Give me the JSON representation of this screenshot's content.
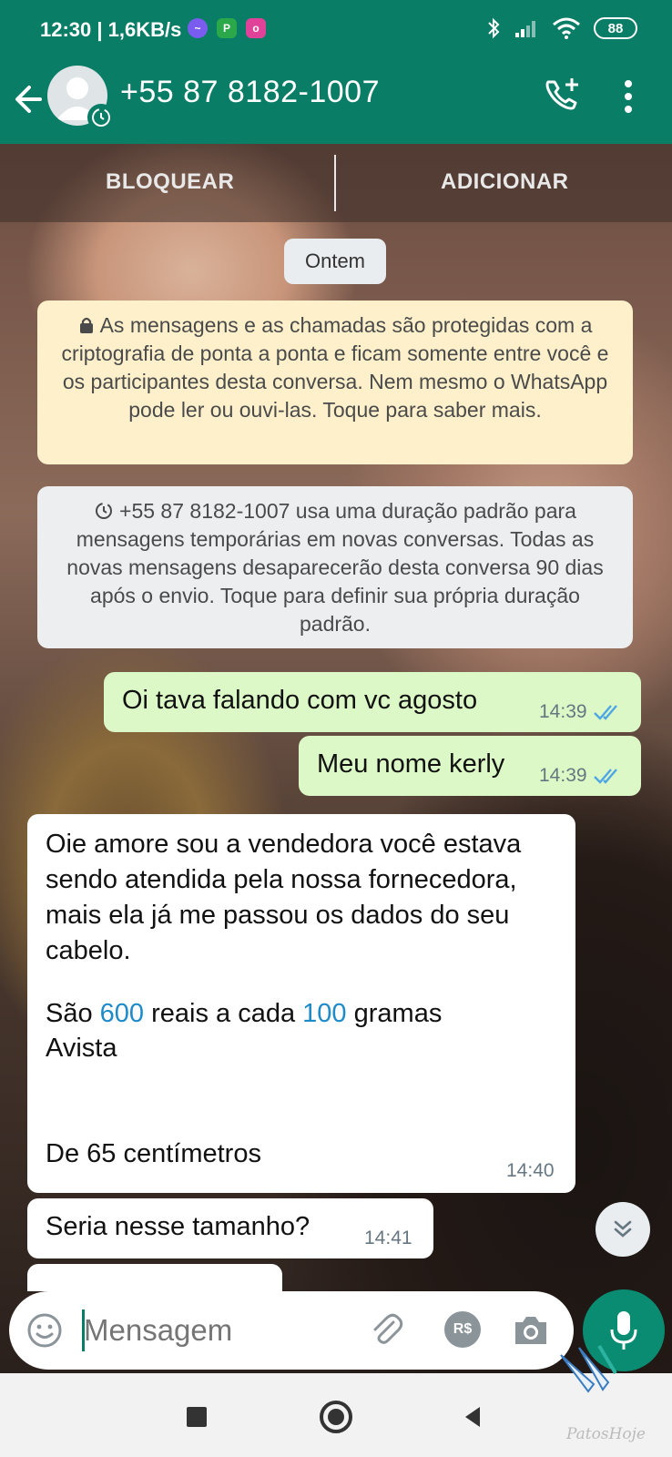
{
  "status_bar": {
    "time": "12:30 | 1,6KB/s",
    "battery": "88"
  },
  "header": {
    "contact": "+55 87 8182-1007"
  },
  "actions": {
    "block": "BLOQUEAR",
    "add": "ADICIONAR"
  },
  "date_chip": "Ontem",
  "notices": {
    "encryption": "As mensagens e as chamadas são protegidas com a criptografia de ponta a ponta e ficam somente entre você e os participantes desta conversa. Nem mesmo o WhatsApp pode ler ou ouvi-las. Toque para saber mais.",
    "temporary": "+55 87 8182-1007 usa uma duração padrão para mensagens temporárias em novas conversas. Todas as novas mensagens desaparecerão desta conversa 90 dias após o envio. Toque para definir sua própria duração padrão."
  },
  "messages": [
    {
      "direction": "out",
      "text": "Oi tava falando com vc agosto",
      "time": "14:39"
    },
    {
      "direction": "out",
      "text": "Meu nome kerly",
      "time": "14:39"
    },
    {
      "direction": "in",
      "line1": "Oie amore sou a vendedora você estava sendo atendida pela nossa fornecedora,  mais ela já me passou os dados do seu cabelo.",
      "price_prefix": "São ",
      "price_value": "600",
      "price_mid": " reais a cada ",
      "price_grams": "100",
      "price_suffix": " gramas",
      "payment": "Avista",
      "length": "De 65 centímetros",
      "time": "14:40"
    },
    {
      "direction": "in",
      "text": "Seria nesse tamanho?",
      "time": "14:41"
    }
  ],
  "composer": {
    "placeholder": "Mensagem",
    "pay_label": "R$"
  },
  "watermark": "PatosHoje",
  "colors": {
    "primary": "#0a7d67",
    "outgoing_bubble": "#dcf8c6",
    "incoming_bubble": "#ffffff",
    "read_ticks": "#4fa6e6",
    "encryption_notice": "#fdf0cb"
  }
}
